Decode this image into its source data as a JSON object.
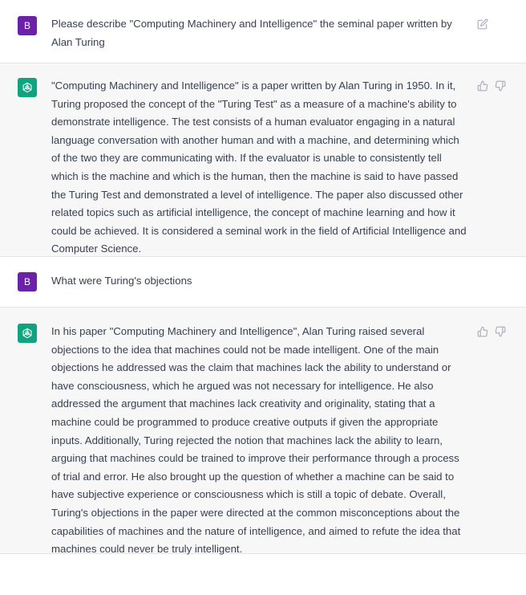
{
  "conversation": {
    "user_avatar_letter": "B",
    "messages": [
      {
        "role": "user",
        "text": "Please describe \"Computing Machinery and Intelligence\" the seminal paper written by Alan Turing"
      },
      {
        "role": "assistant",
        "text": "\"Computing Machinery and Intelligence\" is a paper written by Alan Turing in 1950. In it, Turing proposed the concept of the \"Turing Test\" as a measure of a machine's ability to demonstrate intelligence. The test consists of a human evaluator engaging in a natural language conversation with another human and with a machine, and determining which of the two they are communicating with. If the evaluator is unable to consistently tell which is the machine and which is the human, then the machine is said to have passed the Turing Test and demonstrated a level of intelligence. The paper also discussed other related topics such as artificial intelligence, the concept of machine learning and how it could be achieved. It is considered a seminal work in the field of Artificial Intelligence and Computer Science."
      },
      {
        "role": "user",
        "text": "What were Turing's objections"
      },
      {
        "role": "assistant",
        "text": "In his paper \"Computing Machinery and Intelligence\", Alan Turing raised several objections to the idea that machines could not be made intelligent. One of the main objections he addressed was the claim that machines lack the ability to understand or have consciousness, which he argued was not necessary for intelligence. He also addressed the argument that machines lack creativity and originality, stating that a machine could be programmed to produce creative outputs if given the appropriate inputs. Additionally, Turing rejected the notion that machines lack the ability to learn, arguing that machines could be trained to improve their performance through a process of trial and error. He also brought up the question of whether a machine can be said to have subjective experience or consciousness which is still a topic of debate. Overall, Turing's objections in the paper were directed at the common misconceptions about the capabilities of machines and the nature of intelligence, and aimed to refute the idea that machines could never be truly intelligent."
      }
    ]
  },
  "icons": {
    "user_action": "edit-icon",
    "assistant_actions": [
      "thumbs-up-icon",
      "thumbs-down-icon"
    ]
  },
  "colors": {
    "user_avatar": "#6b21a8",
    "assistant_avatar": "#10a37f",
    "assistant_background": "#f7f7f8",
    "text": "#374151",
    "icon": "#acacbe"
  }
}
